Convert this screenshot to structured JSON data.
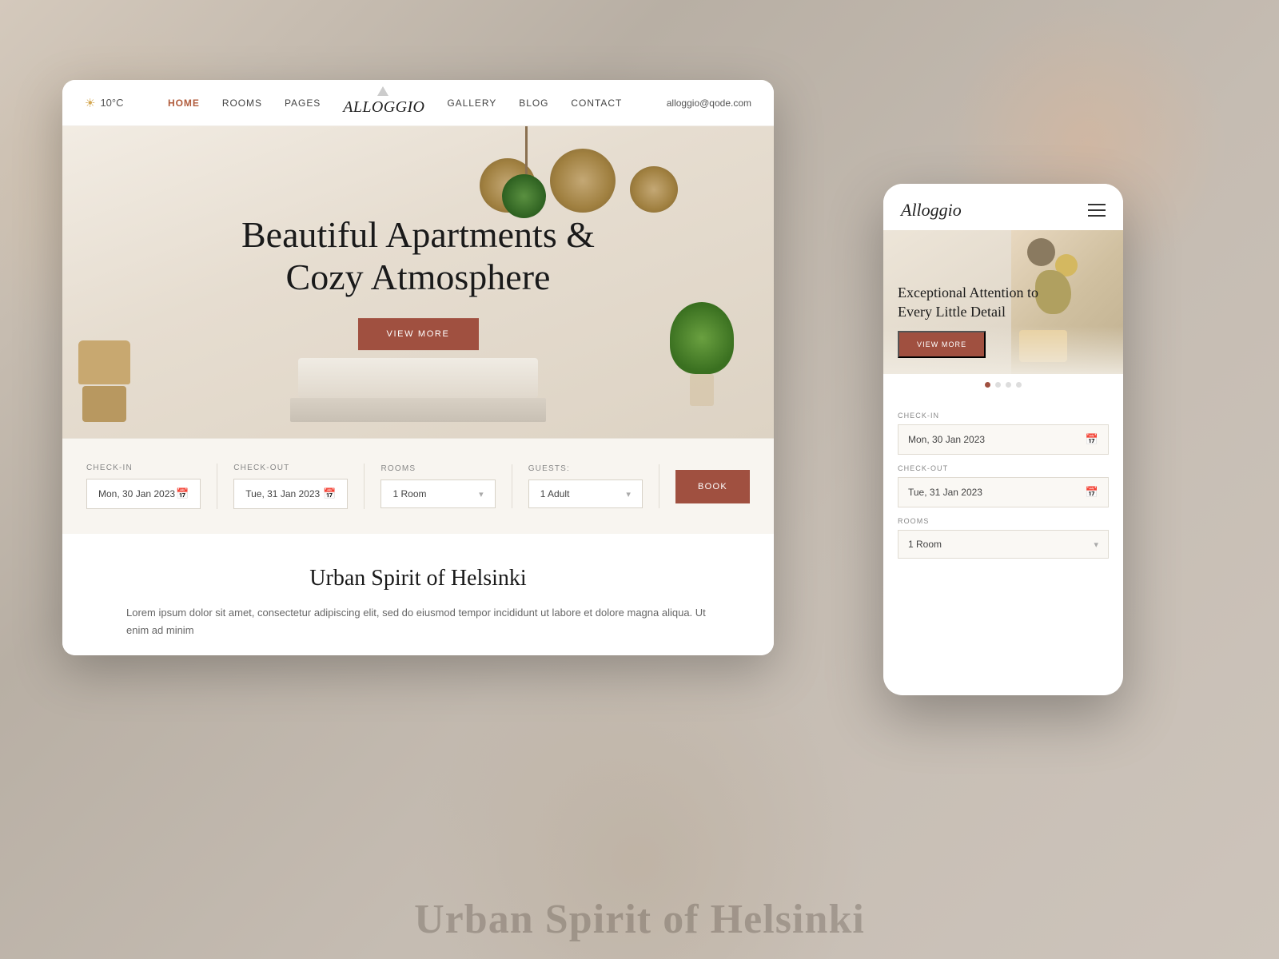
{
  "page": {
    "background_text": "Urban Spirit of Helsinki"
  },
  "desktop": {
    "topbar": {
      "temperature": "10°C",
      "nav_items": [
        {
          "label": "HOME",
          "active": true
        },
        {
          "label": "ROOMS",
          "active": false
        },
        {
          "label": "PAGES",
          "active": false
        },
        {
          "label": "GALLERY",
          "active": false
        },
        {
          "label": "BLOG",
          "active": false
        },
        {
          "label": "CONTACT",
          "active": false
        }
      ],
      "logo": "Alloggio",
      "email": "alloggio@qode.com"
    },
    "hero": {
      "title_line1": "Beautiful Apartments &",
      "title_line2": "Cozy Atmosphere",
      "cta_button": "VIEW MORE"
    },
    "booking": {
      "checkin_label": "CHECK-IN",
      "checkin_value": "Mon, 30 Jan 2023",
      "checkout_label": "CHECK-OUT",
      "checkout_value": "Tue, 31 Jan 2023",
      "rooms_label": "ROOMS",
      "rooms_value": "1 Room",
      "guests_label": "GUESTS:",
      "guests_value": "1 Adult",
      "book_button": "BOOK"
    },
    "body": {
      "title": "Urban Spirit of Helsinki",
      "text": "Lorem ipsum dolor sit amet, consectetur adipiscing elit, sed do eiusmod tempor incididunt ut labore et dolore magna aliqua. Ut enim ad minim"
    }
  },
  "mobile": {
    "logo": "Alloggio",
    "hero": {
      "title_line1": "Exceptional Attention to",
      "title_line2": "Every Little Detail",
      "cta_button": "VIEW MORE"
    },
    "dots": [
      "active",
      "inactive",
      "inactive",
      "inactive"
    ],
    "booking": {
      "checkin_label": "CHECK-IN",
      "checkin_value": "Mon, 30 Jan 2023",
      "checkout_label": "CHECK-OUT",
      "checkout_value": "Tue, 31 Jan 2023",
      "rooms_label": "ROOMS",
      "rooms_value": "1 Room"
    }
  },
  "colors": {
    "accent": "#a05040",
    "nav_active": "#b05a3a",
    "text_primary": "#1a1a1a",
    "text_muted": "#666"
  }
}
